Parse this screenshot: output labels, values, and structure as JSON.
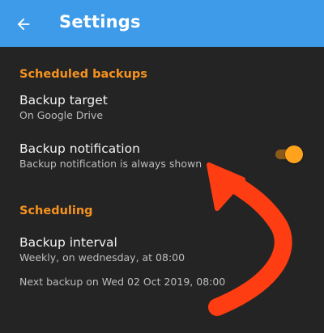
{
  "appbar": {
    "title": "Settings",
    "back_icon": "arrow-left-icon",
    "color": "#3d9be9"
  },
  "sections": {
    "scheduled_backups": "Scheduled backups",
    "scheduling": "Scheduling"
  },
  "backup_target": {
    "title": "Backup target",
    "subtitle": "On Google Drive"
  },
  "backup_notification": {
    "title": "Backup notification",
    "subtitle": "Backup notification is always shown",
    "enabled": true
  },
  "backup_interval": {
    "title": "Backup interval",
    "subtitle": "Weekly, on wednesday, at 08:00"
  },
  "next_backup": "Next backup on Wed 02 Oct 2019, 08:00",
  "colors": {
    "accent": "#f7931e",
    "background": "#242424",
    "annotation": "#ff3d12"
  }
}
